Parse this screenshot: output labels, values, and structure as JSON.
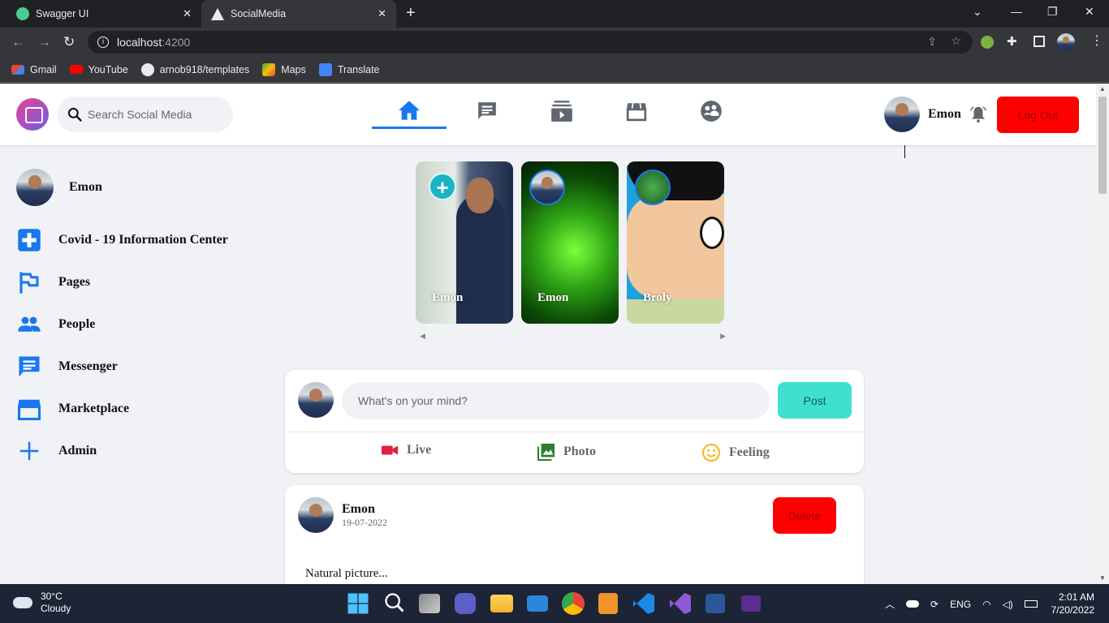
{
  "browser": {
    "tabs": [
      {
        "title": "Swagger UI",
        "icon": "swagger-icon"
      },
      {
        "title": "SocialMedia",
        "icon": "angular-icon"
      }
    ],
    "url_host": "localhost",
    "url_port": ":4200",
    "bookmarks": [
      {
        "label": "Gmail",
        "icon": "gmail-icon"
      },
      {
        "label": "YouTube",
        "icon": "youtube-icon"
      },
      {
        "label": "arnob918/templates",
        "icon": "github-icon"
      },
      {
        "label": "Maps",
        "icon": "maps-icon"
      },
      {
        "label": "Translate",
        "icon": "translate-icon"
      }
    ]
  },
  "header": {
    "search_placeholder": "Search Social Media",
    "nav": [
      "home-icon",
      "messages-icon",
      "watch-icon",
      "marketplace-icon",
      "groups-icon"
    ],
    "user_name": "Emon",
    "logout_label": "Log Out"
  },
  "sidebar": {
    "items": [
      {
        "label": "Emon",
        "icon": "avatar"
      },
      {
        "label": "Covid - 19 Information Center",
        "icon": "plus-square-icon"
      },
      {
        "label": "Pages",
        "icon": "flag-icon"
      },
      {
        "label": "People",
        "icon": "people-icon"
      },
      {
        "label": "Messenger",
        "icon": "messenger-icon"
      },
      {
        "label": "Marketplace",
        "icon": "store-icon"
      },
      {
        "label": "Admin",
        "icon": "plus-icon"
      }
    ]
  },
  "stories": [
    {
      "name": "Emon"
    },
    {
      "name": "Emon"
    },
    {
      "name": "Broly"
    }
  ],
  "create_post": {
    "placeholder": "What's on your mind?",
    "post_label": "Post",
    "actions": [
      {
        "label": "Live",
        "color": "#e41e3f"
      },
      {
        "label": "Photo",
        "color": "#2e7d32"
      },
      {
        "label": "Feeling",
        "color": "#f7b928"
      }
    ]
  },
  "post": {
    "author": "Emon",
    "date": "19-07-2022",
    "delete_label": "Delete",
    "text": "Natural picture..."
  },
  "taskbar": {
    "temperature": "30°C",
    "condition": "Cloudy",
    "language": "ENG",
    "time": "2:01 AM",
    "date": "7/20/2022"
  },
  "colors": {
    "accent": "#1877f2",
    "logout": "#ff0000",
    "post_button": "#40e0d0"
  }
}
